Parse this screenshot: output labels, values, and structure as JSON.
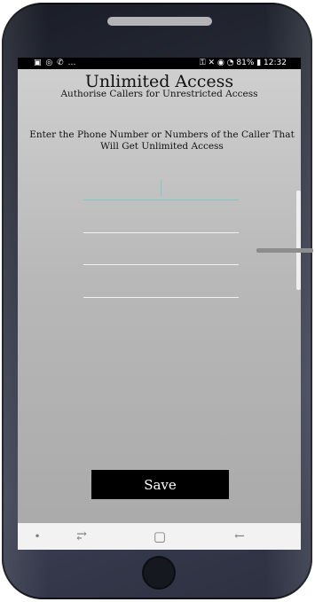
{
  "statusbar": {
    "left_icons": "▣ ◎ ✆ …",
    "right_text": "⚿ ✕ ◉ ◔ 81% ▮ 12:32"
  },
  "header": {
    "title": "Unlimited Access",
    "subtitle": "Authorise Callers for Unrestricted Access"
  },
  "instruction": "Enter the Phone Number or Numbers of the Caller That Will Get Unlimited Access",
  "fields": [
    {
      "value": "",
      "placeholder": ""
    },
    {
      "value": "",
      "placeholder": ""
    },
    {
      "value": "",
      "placeholder": ""
    },
    {
      "value": "",
      "placeholder": ""
    }
  ],
  "save_label": "Save",
  "navbar": {
    "dot": "•",
    "recents": "⥂",
    "home": "▢",
    "back": "←"
  },
  "colors": {
    "accent": "#7fc7c7",
    "button_bg": "#000000"
  }
}
